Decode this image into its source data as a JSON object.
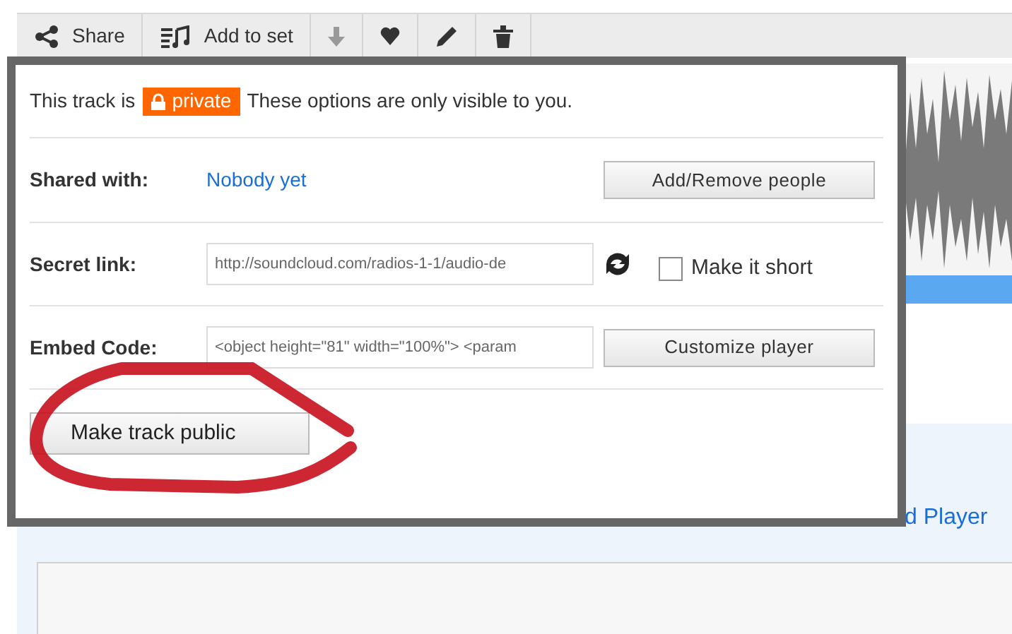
{
  "toolbar": {
    "buttons": [
      {
        "kind": "share",
        "label": "Share"
      },
      {
        "kind": "set",
        "label": "Add to set"
      },
      {
        "kind": "download"
      },
      {
        "kind": "like"
      },
      {
        "kind": "edit"
      },
      {
        "kind": "delete"
      }
    ]
  },
  "popup": {
    "intro_before": "This track is",
    "badge": "private",
    "intro_after": "These options are only visible to you.",
    "shared_with": {
      "label": "Shared with:",
      "value": "Nobody yet",
      "button": "Add/Remove people"
    },
    "secret_link": {
      "label": "Secret link:",
      "value": "http://soundcloud.com/radios-1-1/audio-de",
      "checkbox": {
        "label": "Make it short",
        "checked": false
      }
    },
    "embed_code": {
      "label": "Embed Code:",
      "value": "<object height=\"81\" width=\"100%\"> <param",
      "button": "Customize player"
    },
    "public_button": "Make track public"
  },
  "background_link": "d Player"
}
